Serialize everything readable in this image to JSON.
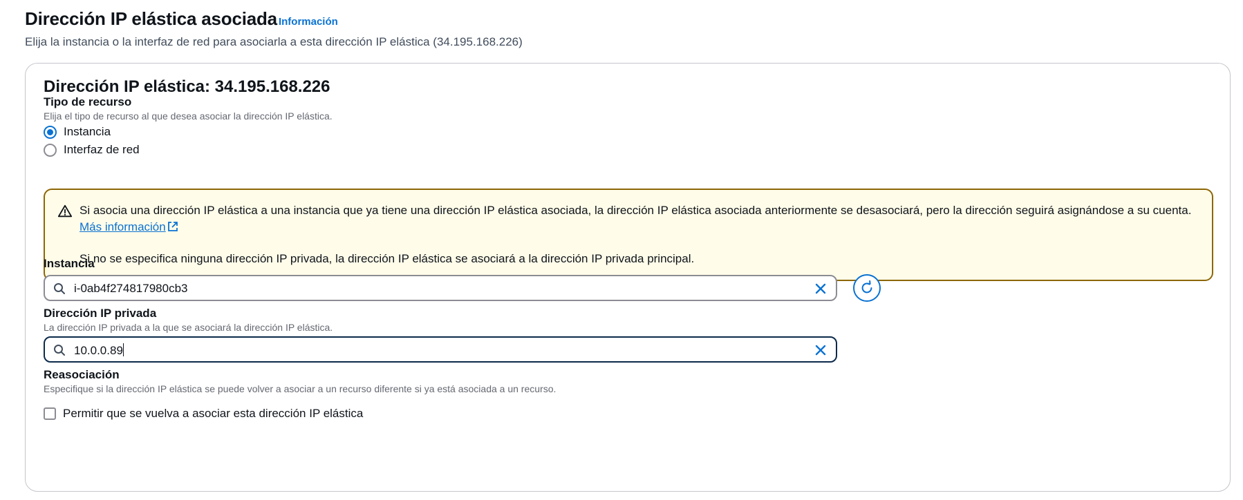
{
  "header": {
    "title": "Dirección IP elástica asociada",
    "info_link": "Información",
    "description": "Elija la instancia o la interfaz de red para asociarla a esta dirección IP elástica (34.195.168.226)"
  },
  "card": {
    "title": "Dirección IP elástica: 34.195.168.226",
    "resource_type": {
      "label": "Tipo de recurso",
      "description": "Elija el tipo de recurso al que desea asociar la dirección IP elástica.",
      "options": [
        {
          "label": "Instancia",
          "selected": true
        },
        {
          "label": "Interfaz de red",
          "selected": false
        }
      ]
    },
    "alert": {
      "icon": "warning-icon",
      "text1": "Si asocia una dirección IP elástica a una instancia que ya tiene una dirección IP elástica asociada, la dirección IP elástica asociada anteriormente se desasociará, pero la dirección seguirá asignándose a su cuenta.",
      "link": "Más información",
      "text2": "Si no se especifica ninguna dirección IP privada, la dirección IP elástica se asociará a la dirección IP privada principal."
    },
    "instance": {
      "label": "Instancia",
      "value": "i-0ab4f274817980cb3"
    },
    "private_ip": {
      "label": "Dirección IP privada",
      "description": "La dirección IP privada a la que se asociará la dirección IP elástica.",
      "value": "10.0.0.89"
    },
    "reassociation": {
      "label": "Reasociación",
      "description": "Especifique si la dirección IP elástica se puede volver a asociar a un recurso diferente si ya está asociada a un recurso.",
      "checkbox_label": "Permitir que se vuelva a asociar esta dirección IP elástica",
      "checked": false
    }
  },
  "colors": {
    "link": "#0972d3",
    "warning_border": "#8d6605",
    "warning_bg": "#fffce9",
    "focus_border": "#0b2a4a"
  }
}
